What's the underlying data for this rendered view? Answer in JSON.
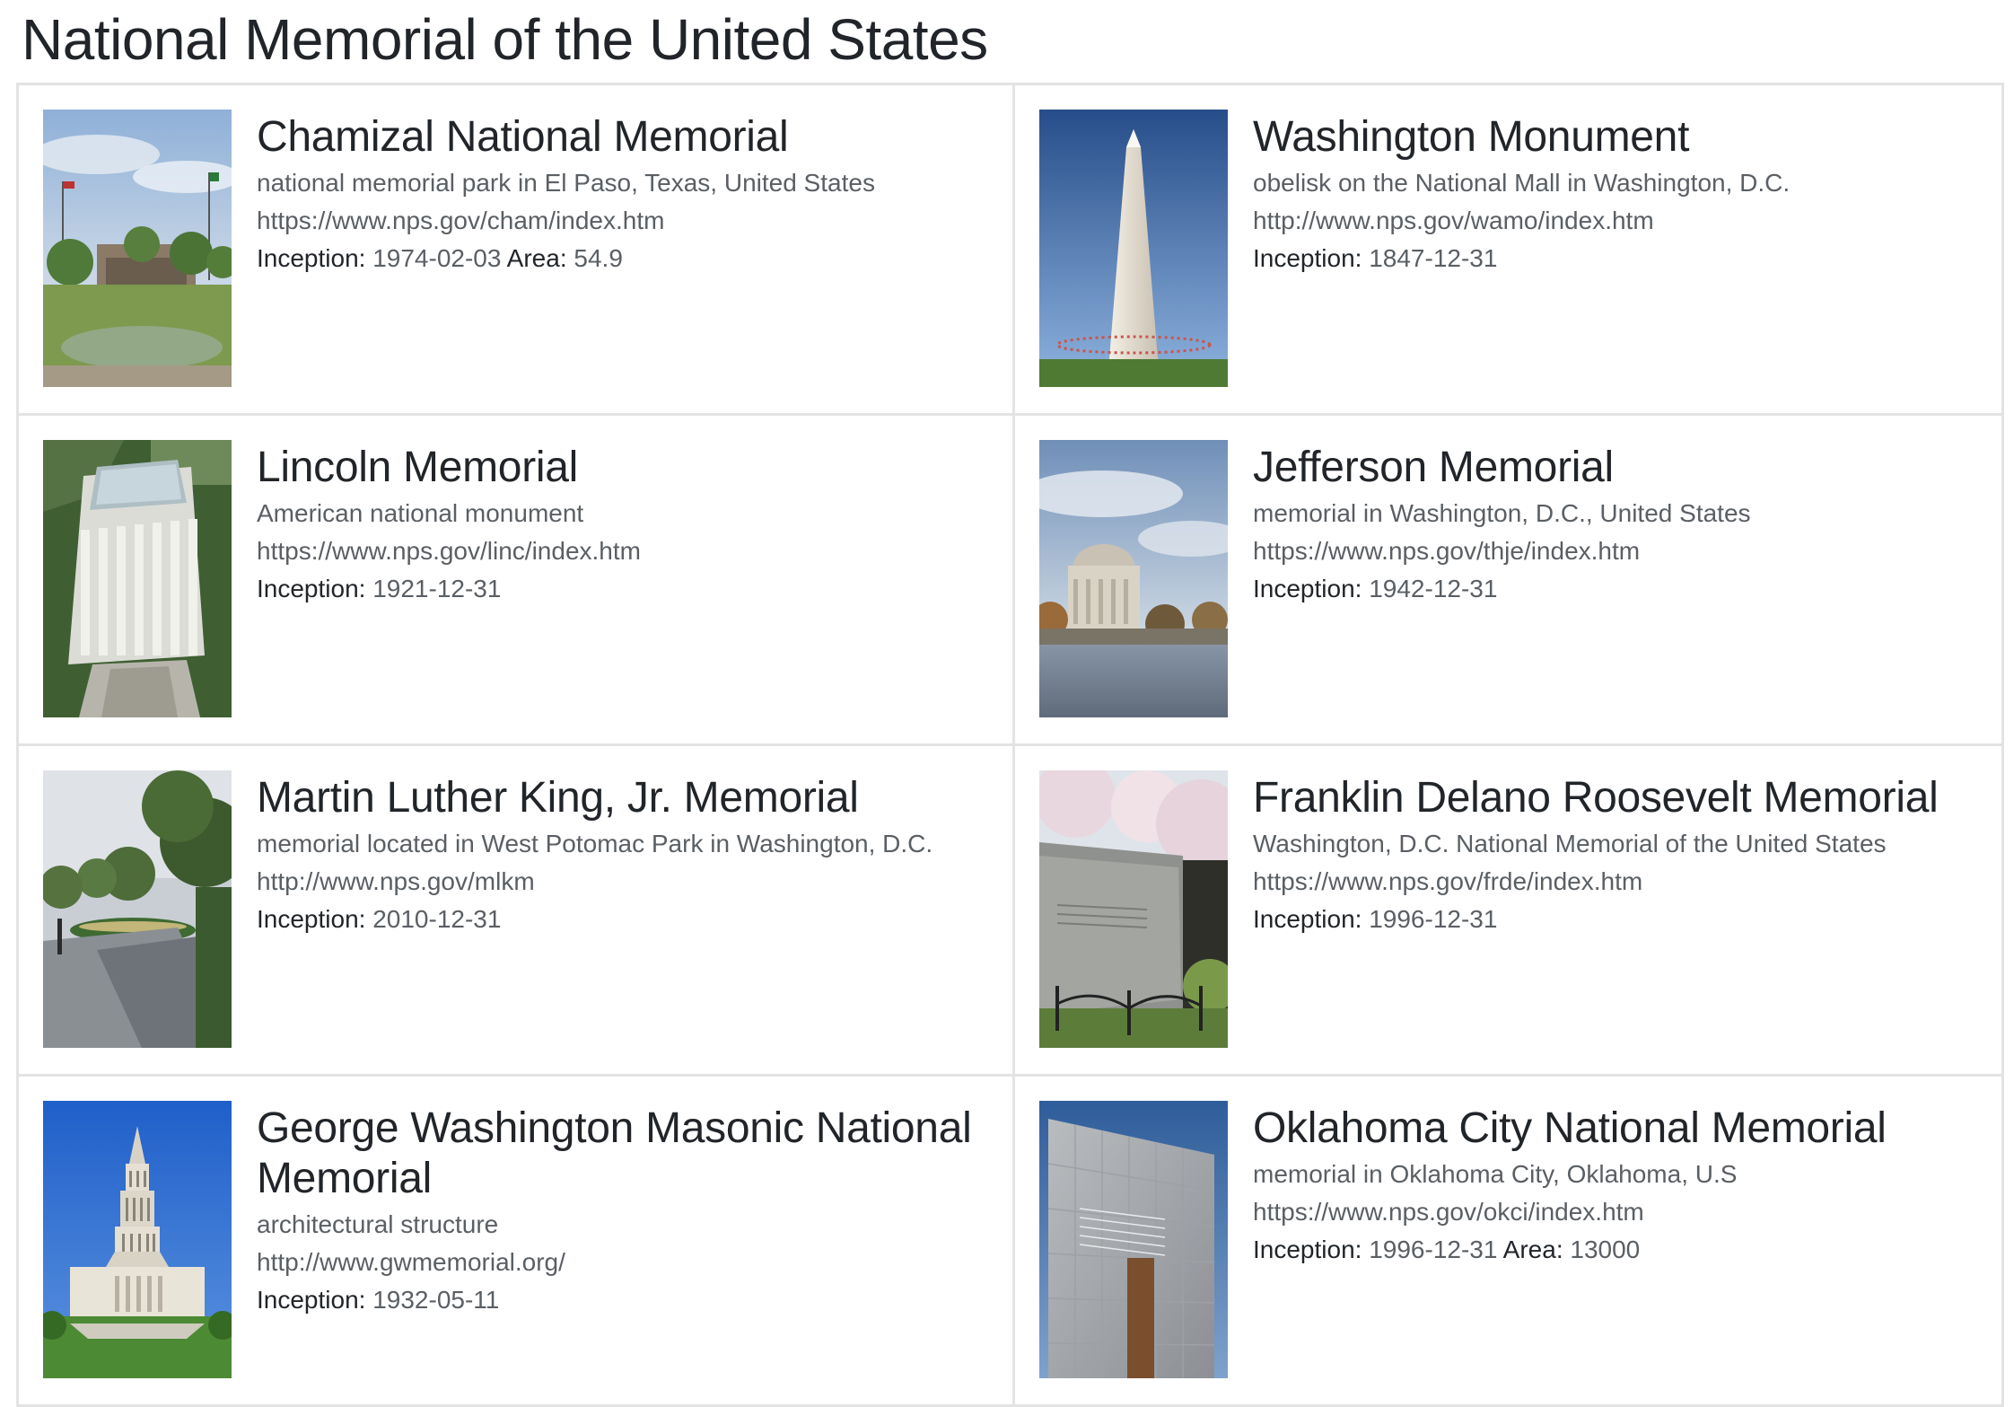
{
  "page": {
    "title": "National Memorial of the United States"
  },
  "labels": {
    "inception": "Inception:",
    "area": "Area:"
  },
  "cards": [
    {
      "title": "Chamizal National Memorial",
      "description": "national memorial park in El Paso, Texas, United States",
      "url": "https://www.nps.gov/cham/index.htm",
      "inception": "1974-02-03",
      "area": "54.9",
      "image": "chamizal-park-photo"
    },
    {
      "title": "Washington Monument",
      "description": "obelisk on the National Mall in Washington, D.C.",
      "url": "http://www.nps.gov/wamo/index.htm",
      "inception": "1847-12-31",
      "image": "washington-monument-photo"
    },
    {
      "title": "Lincoln Memorial",
      "description": "American national monument",
      "url": "https://www.nps.gov/linc/index.htm",
      "inception": "1921-12-31",
      "image": "lincoln-memorial-photo"
    },
    {
      "title": "Jefferson Memorial",
      "description": "memorial in Washington, D.C., United States",
      "url": "https://www.nps.gov/thje/index.htm",
      "inception": "1942-12-31",
      "image": "jefferson-memorial-photo"
    },
    {
      "title": "Martin Luther King, Jr. Memorial",
      "description": "memorial located in West Potomac Park in Washington, D.C.",
      "url": "http://www.nps.gov/mlkm",
      "inception": "2010-12-31",
      "image": "mlk-memorial-photo"
    },
    {
      "title": "Franklin Delano Roosevelt Memorial",
      "description": "Washington, D.C. National Memorial of the United States",
      "url": "https://www.nps.gov/frde/index.htm",
      "inception": "1996-12-31",
      "image": "fdr-memorial-photo"
    },
    {
      "title": "George Washington Masonic National Memorial",
      "description": "architectural structure",
      "url": "http://www.gwmemorial.org/",
      "inception": "1932-05-11",
      "image": "gw-masonic-memorial-photo"
    },
    {
      "title": "Oklahoma City National Memorial",
      "description": "memorial in Oklahoma City, Oklahoma, U.S",
      "url": "https://www.nps.gov/okci/index.htm",
      "inception": "1996-12-31",
      "area": "13000",
      "image": "oklahoma-city-memorial-photo"
    }
  ]
}
